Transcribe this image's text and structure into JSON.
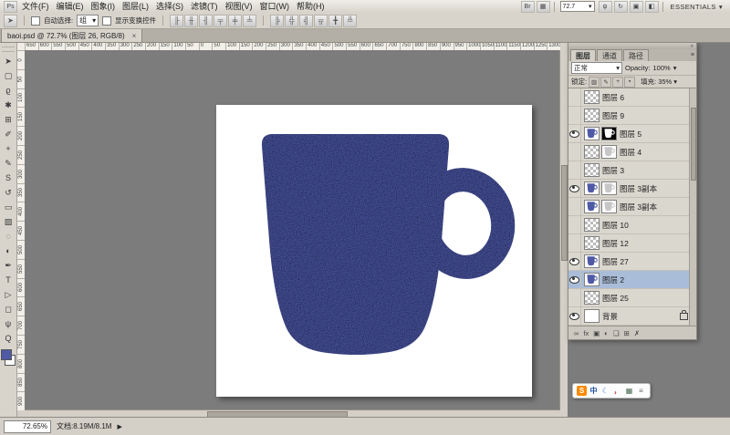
{
  "glyphs": {
    "caret_down": "▾",
    "play_right": "▶",
    "double_right": "»",
    "close": "×",
    "panel_menu": "≡"
  },
  "colors": {
    "mug_blue": "#4f5aa7",
    "page_white": "#ffffff",
    "canvas_gray": "#7c7c7c",
    "selected_row": "#a9bdd9"
  },
  "menu": {
    "items": [
      "文件(F)",
      "编辑(E)",
      "图象(I)",
      "图层(L)",
      "选择(S)",
      "滤镜(T)",
      "视图(V)",
      "窗口(W)",
      "帮助(H)"
    ],
    "icons_a": [
      {
        "id": "bridge-icon",
        "glyph": "Br"
      },
      {
        "id": "view-extras-icon",
        "glyph": "▦"
      }
    ],
    "zoom_level": "72.7",
    "icons_b": [
      {
        "id": "hand-tool-icon",
        "glyph": "ψ"
      },
      {
        "id": "rotate-view-icon",
        "glyph": "↻"
      },
      {
        "id": "arrange-documents-icon",
        "glyph": "▣"
      },
      {
        "id": "screen-mode-icon",
        "glyph": "◧"
      }
    ],
    "workspace": "ESSENTIALS"
  },
  "options_bar": {
    "tool_glyph": "➤",
    "auto_select_label": "自动选择:",
    "auto_select_value": "组",
    "show_transform_label": "显示变换控件",
    "align_icons": [
      "╟",
      "╫",
      "╢",
      "╤",
      "╪",
      "╧"
    ],
    "distribute_icons": [
      "╠",
      "╬",
      "╣",
      "╦",
      "╋",
      "╩"
    ]
  },
  "document_tab": {
    "title": "baoi.psd @ 72.7% (图层 26, RGB/8)"
  },
  "tools": [
    {
      "id": "move-tool",
      "glyph": "➤"
    },
    {
      "id": "marquee-tool",
      "glyph": "▢"
    },
    {
      "id": "lasso-tool",
      "glyph": "ϱ"
    },
    {
      "id": "quick-selection-tool",
      "glyph": "✱"
    },
    {
      "id": "crop-tool",
      "glyph": "⊞"
    },
    {
      "id": "eyedropper-tool",
      "glyph": "✐"
    },
    {
      "id": "healing-brush-tool",
      "glyph": "+"
    },
    {
      "id": "brush-tool",
      "glyph": "✎"
    },
    {
      "id": "clone-stamp-tool",
      "glyph": "S"
    },
    {
      "id": "history-brush-tool",
      "glyph": "↺"
    },
    {
      "id": "eraser-tool",
      "glyph": "▭"
    },
    {
      "id": "gradient-tool",
      "glyph": "▨"
    },
    {
      "id": "blur-tool",
      "glyph": "◌"
    },
    {
      "id": "dodge-tool",
      "glyph": "◐"
    },
    {
      "id": "pen-tool",
      "glyph": "✒"
    },
    {
      "id": "type-tool",
      "glyph": "T"
    },
    {
      "id": "path-selection-tool",
      "glyph": "▷"
    },
    {
      "id": "shape-tool",
      "glyph": "◻"
    },
    {
      "id": "hand-tool",
      "glyph": "ψ"
    },
    {
      "id": "zoom-tool",
      "glyph": "Q"
    }
  ],
  "rulers": {
    "horizontal": [
      "650",
      "600",
      "550",
      "500",
      "450",
      "400",
      "350",
      "300",
      "250",
      "200",
      "150",
      "100",
      "50",
      "0",
      "50",
      "100",
      "150",
      "200",
      "250",
      "300",
      "350",
      "400",
      "450",
      "500",
      "550",
      "600",
      "650",
      "700",
      "750",
      "800",
      "850",
      "900",
      "950",
      "1000",
      "1050",
      "1100",
      "1150",
      "1200",
      "1250",
      "1300"
    ],
    "vertical": [
      "0",
      "50",
      "100",
      "150",
      "200",
      "250",
      "300",
      "350",
      "400",
      "450",
      "500",
      "550",
      "600",
      "650",
      "700",
      "750",
      "800",
      "850",
      "900"
    ]
  },
  "layers_panel": {
    "tabs": [
      {
        "label": "图层",
        "active": true
      },
      {
        "label": "通道",
        "active": false
      },
      {
        "label": "路径",
        "active": false
      }
    ],
    "blend_mode": "正常",
    "opacity_label": "Opacity:",
    "opacity_value": "100%",
    "lock_label": "锁定:",
    "lock_icons": [
      {
        "id": "lock-transparency-icon",
        "glyph": "▨"
      },
      {
        "id": "lock-pixels-icon",
        "glyph": "✎"
      },
      {
        "id": "lock-position-icon",
        "glyph": "+"
      },
      {
        "id": "lock-all-icon",
        "glyph": "▪"
      }
    ],
    "fill_label": "填充:",
    "fill_value": "35%",
    "layers": [
      {
        "name": "图层 6",
        "thumbs": [
          "checker"
        ],
        "eye": false
      },
      {
        "name": "图层 9",
        "thumbs": [
          "checker"
        ],
        "eye": false
      },
      {
        "name": "图层 5",
        "thumbs": [
          "mug",
          "mask-black"
        ],
        "eye": true
      },
      {
        "name": "图层 4",
        "thumbs": [
          "checker",
          "mask-white"
        ],
        "eye": false
      },
      {
        "name": "图层 3",
        "thumbs": [
          "checker"
        ],
        "eye": false
      },
      {
        "name": "图层 3副本",
        "thumbs": [
          "mug",
          "mask-white"
        ],
        "eye": true
      },
      {
        "name": "图层 3副本",
        "thumbs": [
          "mug",
          "mask-white"
        ],
        "eye": false
      },
      {
        "name": "图层 10",
        "thumbs": [
          "checker"
        ],
        "eye": false
      },
      {
        "name": "图层 12",
        "thumbs": [
          "checker"
        ],
        "eye": false
      },
      {
        "name": "图层 27",
        "thumbs": [
          "mug"
        ],
        "eye": true
      },
      {
        "name": "图层 2",
        "thumbs": [
          "mug"
        ],
        "eye": true,
        "selected": true
      },
      {
        "name": "图层 25",
        "thumbs": [
          "checker"
        ],
        "eye": false
      },
      {
        "name": "背景",
        "thumbs": [
          "white"
        ],
        "eye": true,
        "locked": true
      }
    ],
    "bottom_icons": [
      {
        "id": "link-layers-icon",
        "glyph": "∞"
      },
      {
        "id": "layer-style-icon",
        "glyph": "fx"
      },
      {
        "id": "add-mask-icon",
        "glyph": "▣"
      },
      {
        "id": "adjustment-layer-icon",
        "glyph": "◐"
      },
      {
        "id": "layer-group-icon",
        "glyph": "❏"
      },
      {
        "id": "new-layer-icon",
        "glyph": "⊞"
      },
      {
        "id": "delete-layer-icon",
        "glyph": "✗"
      }
    ]
  },
  "status_bar": {
    "zoom": "72.65%",
    "doc_info": "文档:8.19M/8.1M"
  },
  "ime_bar": {
    "icons": [
      {
        "id": "sogou-logo-icon",
        "glyph": "S",
        "bg": "#ff8a00",
        "color": "#ffffff"
      },
      {
        "id": "ime-mode-icon",
        "glyph": "中",
        "color": "#1b4fa0"
      },
      {
        "id": "ime-halfwidth-icon",
        "glyph": "☾",
        "color": "#2b6bd4"
      },
      {
        "id": "ime-punct-icon",
        "glyph": "，",
        "color": "#c23b33"
      },
      {
        "id": "ime-keyboard-icon",
        "glyph": "▦",
        "color": "#4a6a52"
      },
      {
        "id": "ime-menu-icon",
        "glyph": "≡",
        "color": "#666666"
      }
    ]
  }
}
